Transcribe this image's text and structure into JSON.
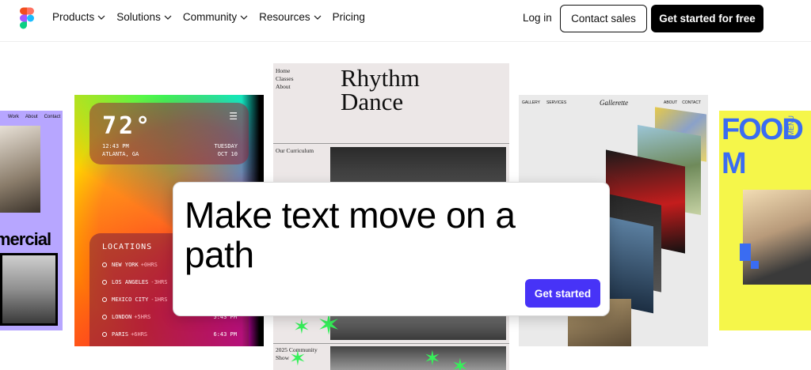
{
  "nav": {
    "links": [
      {
        "label": "Products",
        "dropdown": true
      },
      {
        "label": "Solutions",
        "dropdown": true
      },
      {
        "label": "Community",
        "dropdown": true
      },
      {
        "label": "Resources",
        "dropdown": true
      },
      {
        "label": "Pricing",
        "dropdown": false
      }
    ],
    "login": "Log in",
    "contact_sales": "Contact sales",
    "get_started_free": "Get started for free"
  },
  "cards": {
    "commercial": {
      "links": [
        "Work",
        "About",
        "Contact"
      ],
      "word": "mercial"
    },
    "weather": {
      "temp": "72°",
      "time": "12:43 PM",
      "city": "ATLANTA, GA",
      "day": "TUESDAY",
      "date": "OCT 10",
      "locations_title": "LOCATIONS",
      "locations": [
        {
          "city": "NEW YORK",
          "offset": "+0HRS",
          "time": ""
        },
        {
          "city": "LOS ANGELES",
          "offset": "-3HRS",
          "time": ""
        },
        {
          "city": "MEXICO CITY",
          "offset": "-1HRS",
          "time": ""
        },
        {
          "city": "LONDON",
          "offset": "+5HRS",
          "time": "5:43 PM"
        },
        {
          "city": "PARIS",
          "offset": "+6HRS",
          "time": "6:43 PM"
        }
      ]
    },
    "rhythm": {
      "nav": [
        "Home",
        "Classes",
        "About"
      ],
      "title_line1": "Rhythm",
      "title_line2": "Dance",
      "curriculum": "Our Curriculum",
      "show_line1": "2025 Community",
      "show_line2": "Show"
    },
    "gallerette": {
      "nav_left": [
        "GALLERY",
        "SERVICES"
      ],
      "brand": "Gallerette",
      "nav_right": [
        "ABOUT",
        "CONTACT"
      ]
    },
    "food": {
      "title": "FOOD M",
      "menu": "MENU"
    }
  },
  "dialog": {
    "title": "Make text move on a path",
    "button": "Get started"
  },
  "colors": {
    "brand_button": "#4733f7",
    "dark_button": "#000000",
    "food_blue": "#3a6cf2",
    "food_yellow": "#f5f64a",
    "lavender": "#b7a6ff",
    "star_green": "#36f05a"
  }
}
